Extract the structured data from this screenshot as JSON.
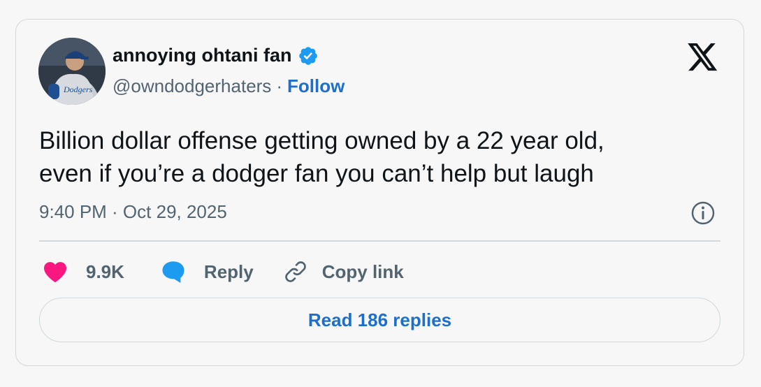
{
  "author": {
    "display_name": "annoying ohtani fan",
    "handle": "@owndodgerhaters",
    "separator": "·",
    "follow_label": "Follow",
    "verified": true,
    "avatar_icon": "baseball-player-photo"
  },
  "tweet": {
    "text_line1": "Billion dollar offense getting owned by a 22 year old,",
    "text_line2": "even if you’re a dodger fan you can’t help but laugh",
    "timestamp": "9:40 PM · Oct 29, 2025"
  },
  "actions": {
    "likes_count": "9.9K",
    "reply_label": "Reply",
    "copy_link_label": "Copy link"
  },
  "read_replies_label": "Read 186 replies",
  "icons": {
    "like": "heart-icon",
    "reply": "speech-bubble-icon",
    "copy": "link-icon",
    "brand": "x-logo-icon",
    "info": "info-icon",
    "verified": "verified-badge-icon"
  },
  "colors": {
    "like": "#f91880",
    "reply": "#1d9bf0",
    "link": "#1d6fc9",
    "verified": "#1d9bf0",
    "text_primary": "#0f1419",
    "text_secondary": "#536471"
  }
}
